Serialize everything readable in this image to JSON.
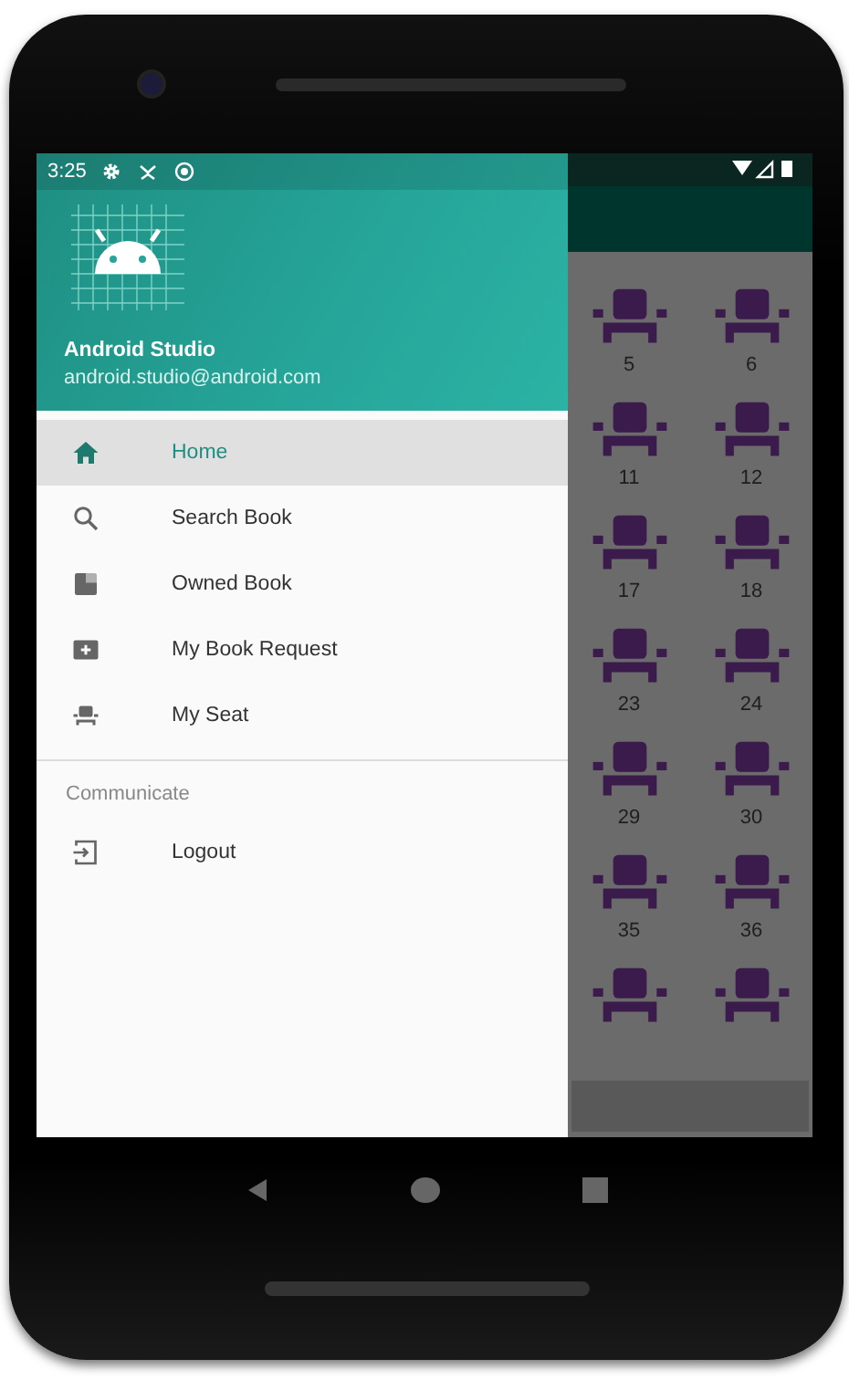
{
  "status_bar": {
    "time": "3:25"
  },
  "drawer": {
    "header": {
      "name": "Android Studio",
      "email": "android.studio@android.com"
    },
    "items": [
      {
        "label": "Home",
        "selected": true
      },
      {
        "label": "Search Book",
        "selected": false
      },
      {
        "label": "Owned Book",
        "selected": false
      },
      {
        "label": "My Book Request",
        "selected": false
      },
      {
        "label": "My Seat",
        "selected": false
      }
    ],
    "section": {
      "title": "Communicate",
      "items": [
        {
          "label": "Logout",
          "selected": false
        }
      ]
    }
  },
  "seats": [
    {
      "kind": "labeled",
      "label": "5"
    },
    {
      "kind": "labeled",
      "label": "6"
    },
    {
      "kind": "labeled",
      "label": "11"
    },
    {
      "kind": "labeled",
      "label": "12"
    },
    {
      "kind": "labeled",
      "label": "17"
    },
    {
      "kind": "labeled",
      "label": "18"
    },
    {
      "kind": "labeled",
      "label": "23"
    },
    {
      "kind": "labeled",
      "label": "24"
    },
    {
      "kind": "labeled",
      "label": "29"
    },
    {
      "kind": "labeled",
      "label": "30"
    },
    {
      "kind": "labeled",
      "label": "35"
    },
    {
      "kind": "labeled",
      "label": "36"
    },
    {
      "kind": "icon_only"
    },
    {
      "kind": "icon_only"
    }
  ]
}
